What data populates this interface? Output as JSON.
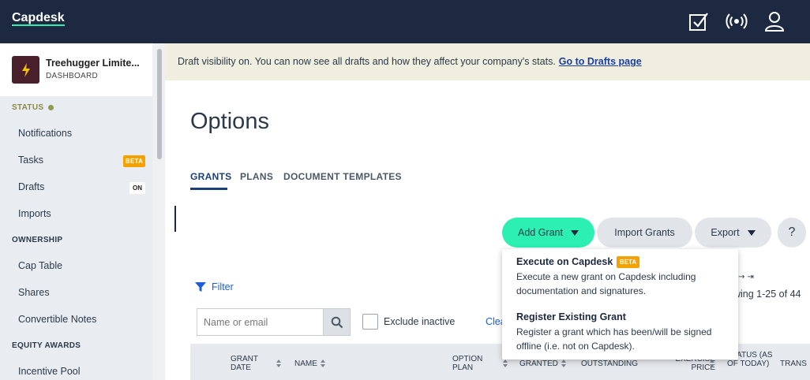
{
  "app": {
    "logo": "Capdesk"
  },
  "account": {
    "name": "Treehugger Limite...",
    "subtitle": "DASHBOARD"
  },
  "sidebar": {
    "status_heading": "STATUS",
    "status_items": [
      {
        "label": "Notifications"
      },
      {
        "label": "Tasks",
        "badge": "BETA"
      },
      {
        "label": "Drafts",
        "badge": "ON"
      },
      {
        "label": "Imports"
      }
    ],
    "ownership_heading": "OWNERSHIP",
    "ownership_items": [
      {
        "label": "Cap Table"
      },
      {
        "label": "Shares"
      },
      {
        "label": "Convertible Notes"
      }
    ],
    "equity_heading": "EQUITY AWARDS",
    "equity_items": [
      {
        "label": "Incentive Pool"
      }
    ]
  },
  "banner": {
    "text": "Draft visibility on. You can now see all drafts and how they affect your company's stats.",
    "link": "Go to Drafts page"
  },
  "page": {
    "title": "Options",
    "tabs": [
      {
        "label": "GRANTS",
        "active": true
      },
      {
        "label": "PLANS",
        "active": false
      },
      {
        "label": "DOCUMENT TEMPLATES",
        "active": false
      }
    ]
  },
  "actions": {
    "add_grant": "Add Grant",
    "import_grants": "Import Grants",
    "export": "Export",
    "help": "?"
  },
  "dropdown": {
    "items": [
      {
        "title": "Execute on Capdesk",
        "badge": "BETA",
        "description": "Execute a new grant on Capdesk including documentation and signatures."
      },
      {
        "title": "Register Existing Grant",
        "description": "Register a grant which has been/will be signed offline (i.e. not on Capdesk)."
      }
    ]
  },
  "filters": {
    "filter_label": "Filter",
    "search_placeholder": "Name or email",
    "exclude_inactive": "Exclude inactive",
    "clear_link": "Clea",
    "pager_arrows": "→ ⇥",
    "showing": "wing 1-25 of 44"
  },
  "table": {
    "columns": [
      {
        "label": "GRANT DATE",
        "sortable": true
      },
      {
        "label": "NAME",
        "sortable": true
      },
      {
        "label": "OPTION PLAN",
        "sortable": true
      },
      {
        "label": "GRANTED",
        "sortable": true
      },
      {
        "label": "OUTSTANDING",
        "sortable": false
      },
      {
        "label": "EXERCISE PRICE",
        "sortable": true
      },
      {
        "label": "STATUS (AS OF TODAY)",
        "sortable": false
      },
      {
        "label": "TRANS",
        "sortable": false
      }
    ]
  },
  "colors": {
    "topbar": "#1d2940",
    "accent": "#2bf0b1",
    "banner": "#f0eedf",
    "beta_badge": "#f5a100",
    "link": "#1a5fd6"
  },
  "icons": [
    "checklist-icon",
    "broadcast-icon",
    "user-icon",
    "filter-icon",
    "search-icon"
  ]
}
